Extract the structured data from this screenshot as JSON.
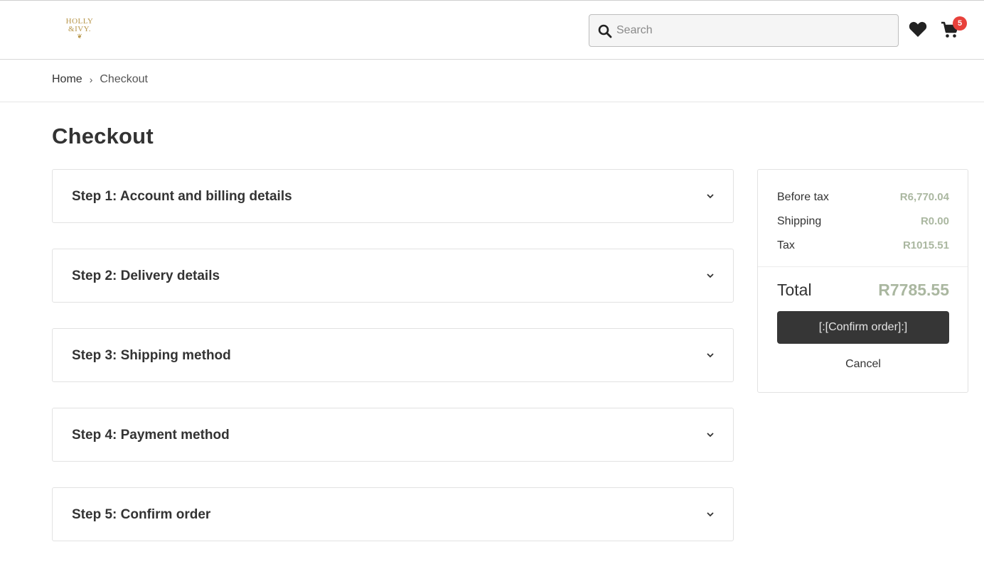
{
  "header": {
    "logo_line1": "HOLLY",
    "logo_line2": "&IVY.",
    "search_placeholder": "Search",
    "cart_count": "5"
  },
  "breadcrumb": {
    "home": "Home",
    "separator": "›",
    "current": "Checkout"
  },
  "page": {
    "title": "Checkout"
  },
  "steps": [
    {
      "label": "Step 1: Account and billing details"
    },
    {
      "label": "Step 2: Delivery details"
    },
    {
      "label": "Step 3: Shipping method"
    },
    {
      "label": "Step 4: Payment method"
    },
    {
      "label": "Step 5: Confirm order"
    }
  ],
  "summary": {
    "before_tax_label": "Before tax",
    "before_tax_value": "R6,770.04",
    "shipping_label": "Shipping",
    "shipping_value": "R0.00",
    "tax_label": "Tax",
    "tax_value": "R1015.51",
    "total_label": "Total",
    "total_value": "R7785.55",
    "confirm_label": "[:[Confirm order]:]",
    "cancel_label": "Cancel"
  },
  "icons": {
    "search": "search-icon",
    "wishlist": "heart-icon",
    "cart": "cart-icon",
    "step_toggle": "chevron-down-icon"
  },
  "colors": {
    "accent_price": "#aab7a0",
    "button_dark": "#363636",
    "badge": "#e8413b",
    "logo_gold": "#b8964a"
  }
}
